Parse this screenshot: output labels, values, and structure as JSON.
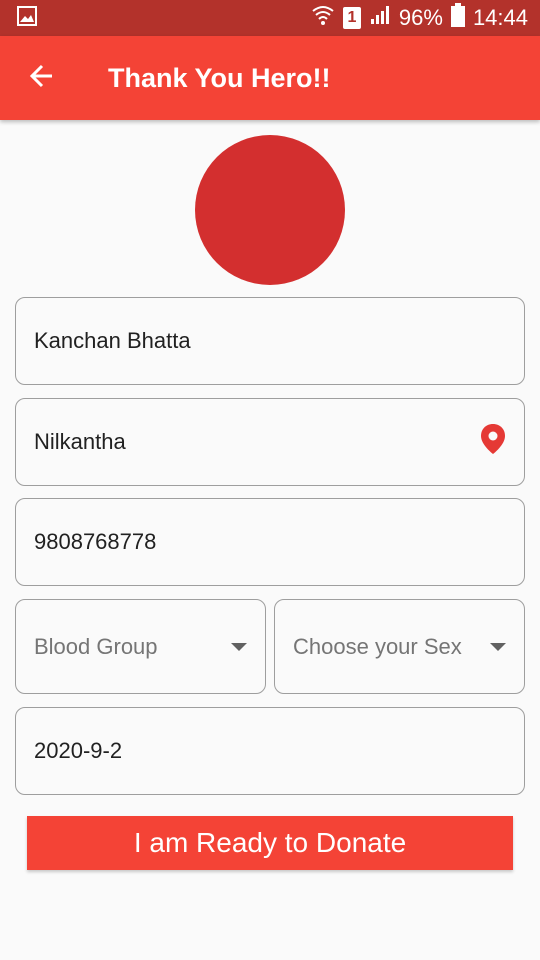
{
  "status_bar": {
    "battery": "96%",
    "time": "14:44",
    "sim_label": "1",
    "icons": [
      "gallery-icon",
      "wifi-icon",
      "sim-icon",
      "signal-icon",
      "battery-icon"
    ]
  },
  "app_bar": {
    "title": "Thank You Hero!!",
    "back_icon": "arrow-back-icon",
    "color": "#f44336"
  },
  "avatar": {
    "color": "#d32f2f"
  },
  "form": {
    "name": "Kanchan Bhatta",
    "location": "Nilkantha",
    "location_icon": "location-pin-icon",
    "phone": "9808768778",
    "blood_group_placeholder": "Blood Group",
    "sex_placeholder": "Choose your Sex",
    "date": "2020-9-2"
  },
  "donate_button": {
    "label": "I am Ready to Donate"
  },
  "colors": {
    "status_bar": "#b3322b",
    "primary": "#f44336",
    "avatar": "#d32f2f",
    "pin": "#e53935",
    "border": "#9e9e9e"
  }
}
